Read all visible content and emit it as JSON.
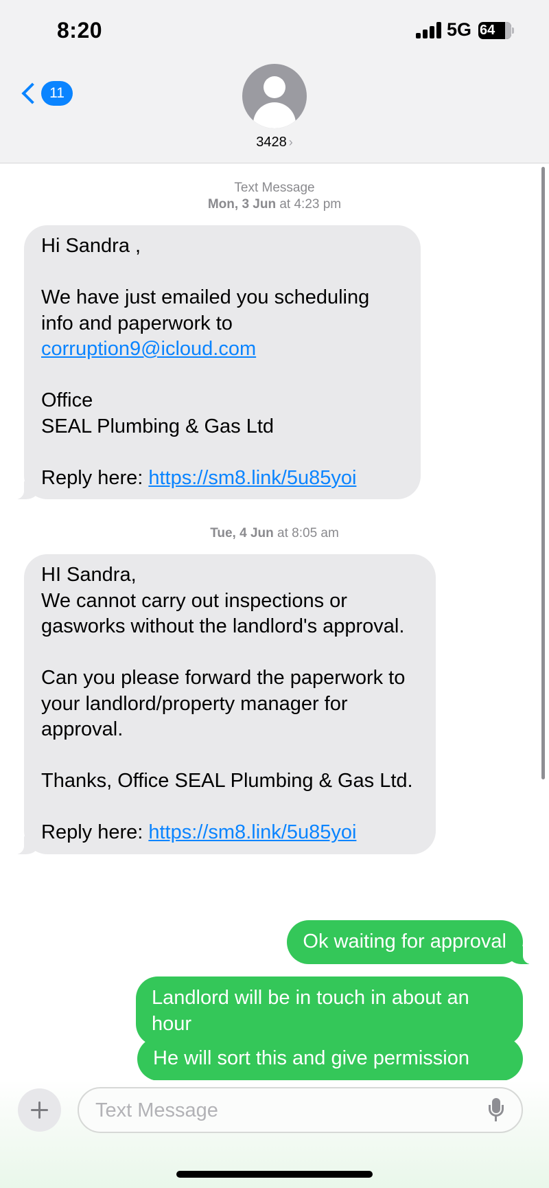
{
  "status_bar": {
    "time": "8:20",
    "network": "5G",
    "battery": "64"
  },
  "header": {
    "back_count": "11",
    "contact": "3428"
  },
  "timestamps": [
    {
      "label": "Text Message",
      "day": "Mon, 3 Jun",
      "time": "at 4:23 pm"
    },
    {
      "day": "Tue, 4 Jun",
      "time": "at 8:05 am"
    }
  ],
  "incoming": [
    {
      "text_1": "Hi Sandra ,\n\nWe have just emailed you scheduling info and paperwork to\n",
      "email": "corruption9@icloud.com",
      "text_2": "\n\nOffice\nSEAL Plumbing & Gas Ltd\n\nReply here: ",
      "link": "https://sm8.link/5u85yoi"
    },
    {
      "text_1": "HI Sandra,\nWe cannot carry out inspections or gasworks without the landlord's approval.\n\nCan you please forward the paperwork to your landlord/property manager for approval.\n\nThanks, Office SEAL Plumbing & Gas Ltd.\n\nReply here: ",
      "link": "https://sm8.link/5u85yoi"
    }
  ],
  "outgoing": [
    "Ok waiting for approval",
    "Landlord will be in touch in about an hour",
    "He will sort this and give permission"
  ],
  "composer": {
    "placeholder": "Text Message"
  },
  "colors": {
    "accent_blue": "#0a84ff",
    "sent_green": "#34c759",
    "received_gray": "#e9e9eb"
  },
  "icons": [
    "signal-icon",
    "battery-icon",
    "back-chevron-icon",
    "contact-avatar-icon",
    "plus-icon",
    "microphone-icon"
  ]
}
